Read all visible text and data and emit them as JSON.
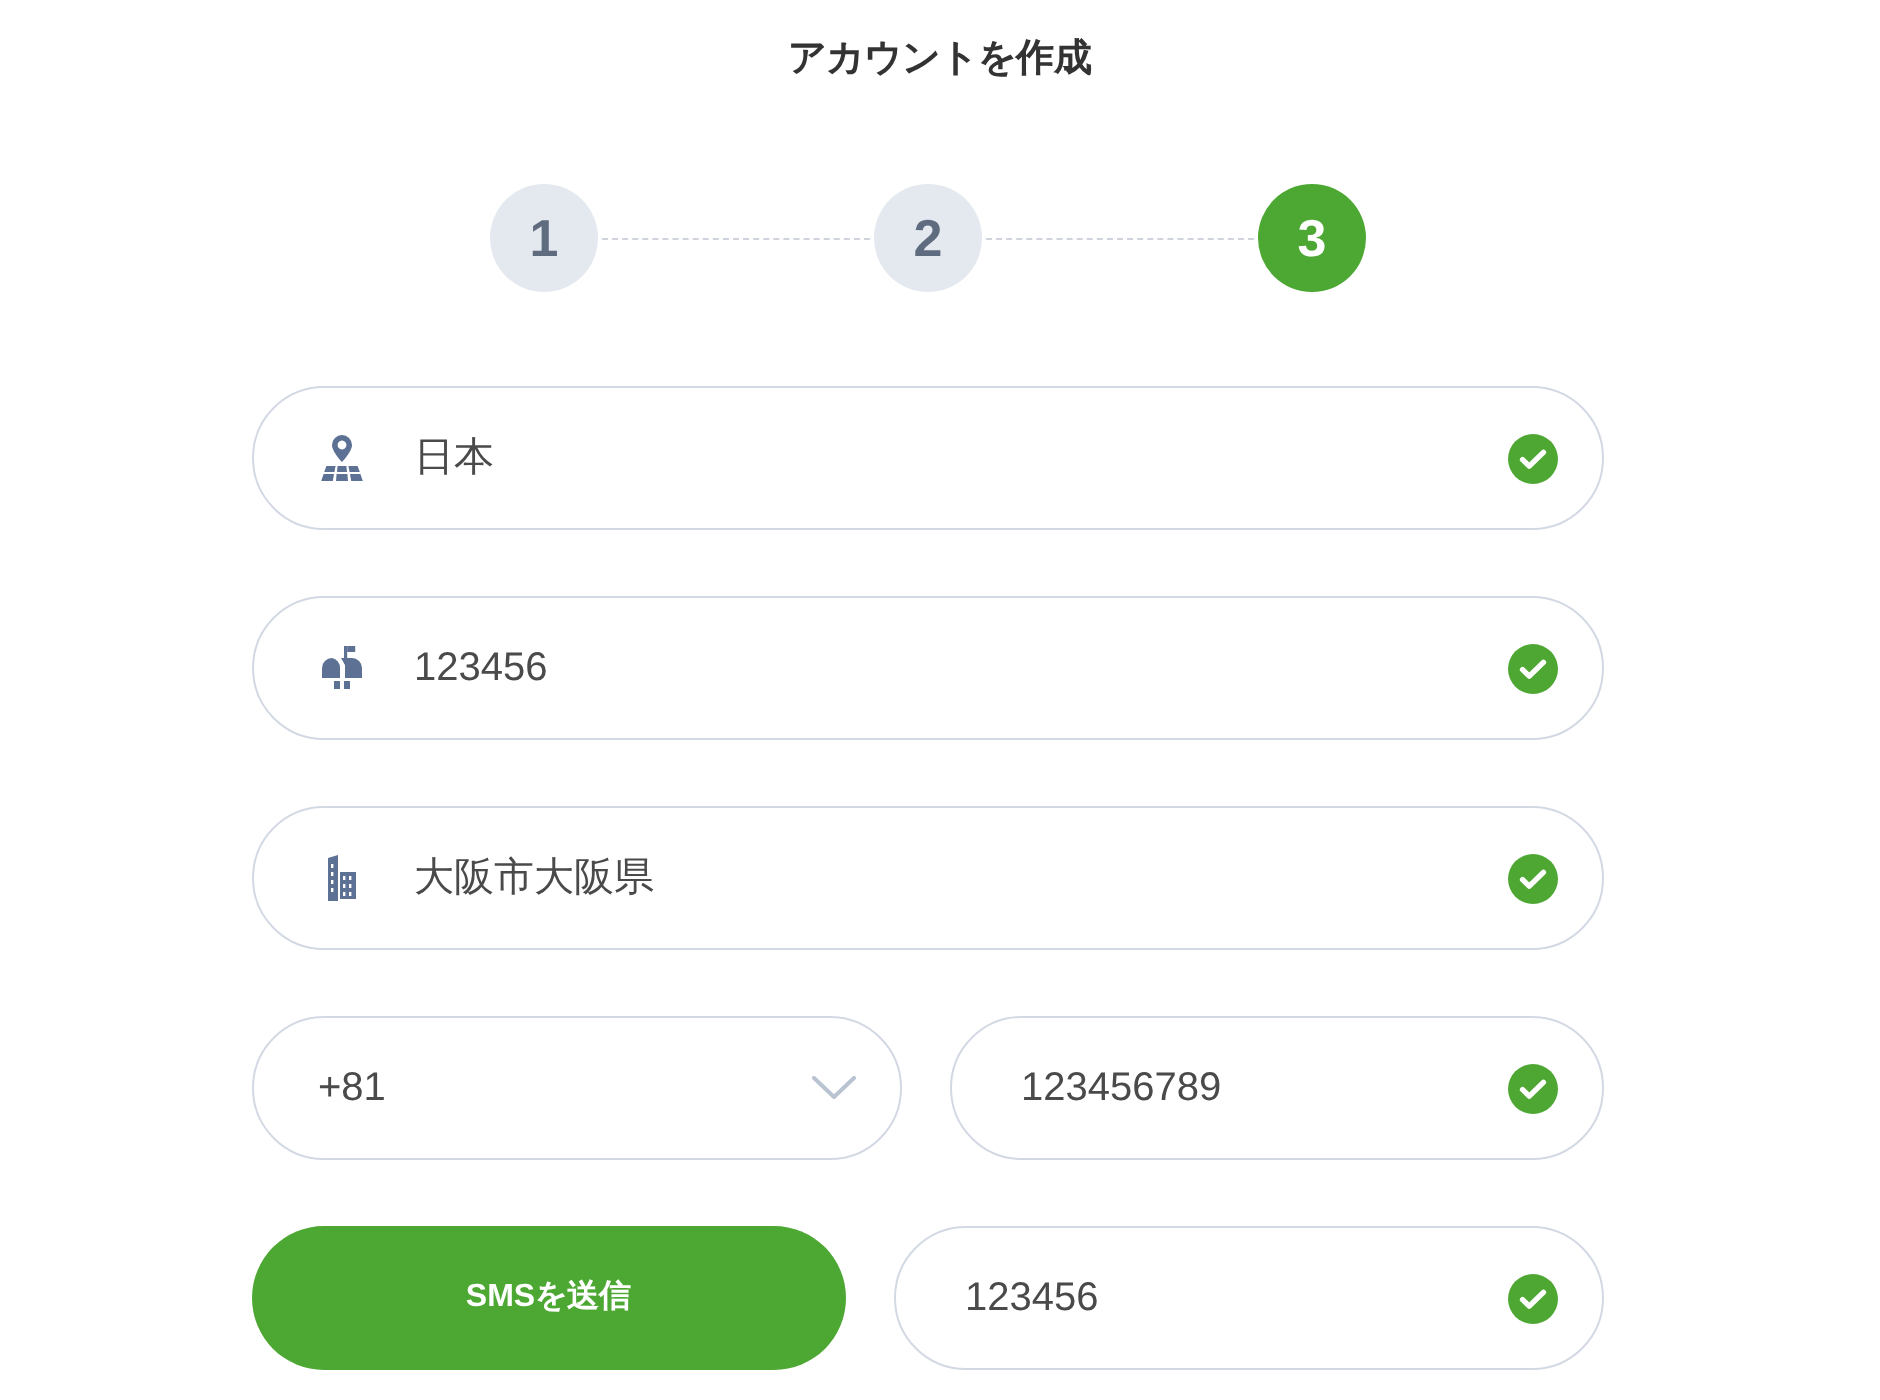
{
  "header": {
    "title": "アカウントを作成"
  },
  "steps": [
    {
      "label": "1",
      "selected": false
    },
    {
      "label": "2",
      "selected": false
    },
    {
      "label": "3",
      "selected": true
    }
  ],
  "address_fields": [
    {
      "value": "日本",
      "valid": true
    },
    {
      "value": "123456",
      "valid": true
    },
    {
      "value": "大阪市大阪県",
      "valid": true
    }
  ],
  "phone": {
    "country_code": {
      "value": "+81"
    },
    "number": {
      "value": "123456789",
      "valid": true
    }
  },
  "verification": {
    "button": "SMSを送信",
    "code": {
      "value": "123456",
      "valid": true
    }
  }
}
